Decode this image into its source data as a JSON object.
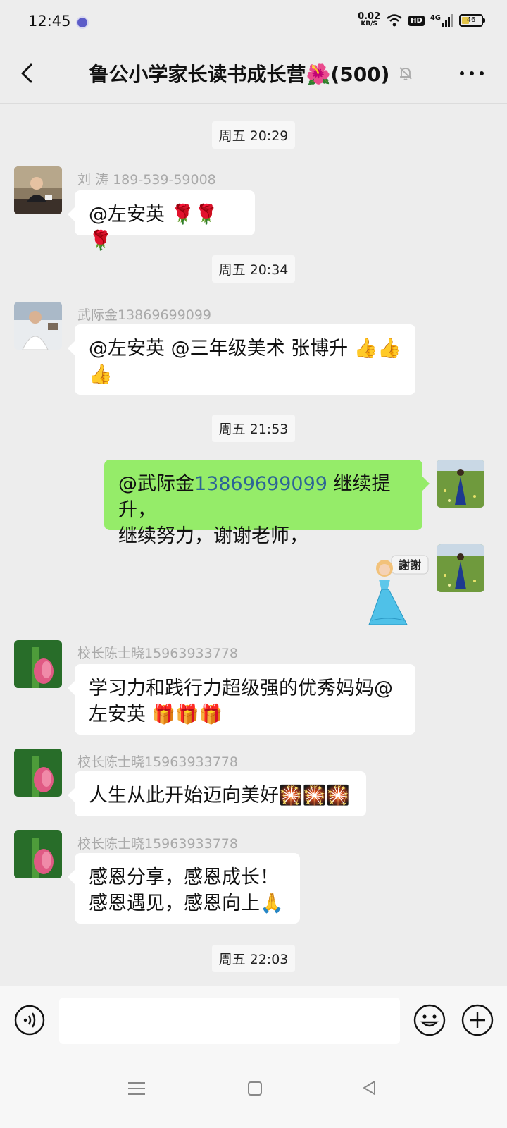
{
  "status_bar": {
    "time": "12:45",
    "net_speed_value": "0.02",
    "net_speed_unit": "KB/S",
    "hd_badge": "HD",
    "network": "4G",
    "battery": "46"
  },
  "header": {
    "title": "鲁公小学家长读书成长营🌺(500)"
  },
  "messages": {
    "t1": "周五 20:29",
    "m1_sender": "刘 涛 189-539-59008",
    "m1_text": "@左安英 🌹🌹🌹",
    "t2": "周五 20:34",
    "m2_sender": "武际金13869699099",
    "m2_line1": "@左安英 @三年级美术 张博升 👍👍",
    "m2_line2": "👍",
    "t3": "周五 21:53",
    "m3_prefix": "@武际金",
    "m3_number": "13869699099",
    "m3_suffix": " 继续提升，",
    "m3_line2": "继续努力，谢谢老师，",
    "sticker_text": "謝謝",
    "m5_sender": "校长陈士晓15963933778",
    "m5_line1": "学习力和践行力超级强的优秀妈妈@",
    "m5_line2": "左安英 🎁🎁🎁",
    "m6_sender": "校长陈士晓15963933778",
    "m6_text": "人生从此开始迈向美好🎇🎇🎇",
    "m7_sender": "校长陈士晓15963933778",
    "m7_line1": "感恩分享，感恩成长！",
    "m7_line2": "感恩遇见，感恩向上🙏",
    "t4": "周五 22:03"
  },
  "input": {
    "placeholder": ""
  },
  "icons": {
    "back": "back-arrow-icon",
    "mute": "mute-bell-icon",
    "more": "more-dots-icon",
    "voice": "voice-icon",
    "emoji": "emoji-icon",
    "plus": "plus-icon"
  },
  "colors": {
    "background": "#ededed",
    "own_bubble": "#95ec69",
    "other_bubble": "#ffffff",
    "mention_number": "#2d6496"
  }
}
